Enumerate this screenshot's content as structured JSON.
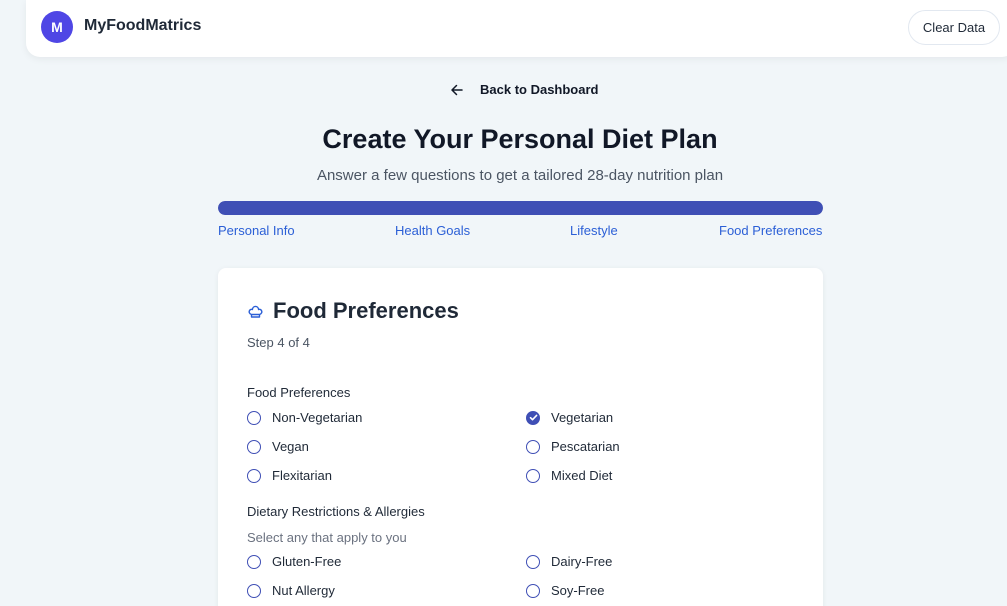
{
  "header": {
    "logo_letter": "M",
    "brand": "MyFoodMatrics",
    "clear_label": "Clear Data"
  },
  "back_label": "Back to Dashboard",
  "title": "Create Your Personal Diet Plan",
  "subtitle": "Answer a few questions to get a tailored 28-day nutrition plan",
  "progress": {
    "fraction": 1.0,
    "steps": [
      "Personal Info",
      "Health Goals",
      "Lifestyle",
      "Food Preferences"
    ]
  },
  "card": {
    "title": "Food Preferences",
    "step_text": "Step 4 of 4",
    "food_label": "Food Preferences",
    "food_options": [
      {
        "label": "Non-Vegetarian",
        "checked": false
      },
      {
        "label": "Vegetarian",
        "checked": true
      },
      {
        "label": "Vegan",
        "checked": false
      },
      {
        "label": "Pescatarian",
        "checked": false
      },
      {
        "label": "Flexitarian",
        "checked": false
      },
      {
        "label": "Mixed Diet",
        "checked": false
      }
    ],
    "restrictions_label": "Dietary Restrictions & Allergies",
    "restrictions_hint": "Select any that apply to you",
    "restriction_options": [
      {
        "label": "Gluten-Free",
        "checked": false
      },
      {
        "label": "Dairy-Free",
        "checked": false
      },
      {
        "label": "Nut Allergy",
        "checked": false
      },
      {
        "label": "Soy-Free",
        "checked": false
      }
    ]
  },
  "colors": {
    "accent": "#3f4fb5",
    "link": "#2b5fd6",
    "logo": "#4f46e5"
  }
}
